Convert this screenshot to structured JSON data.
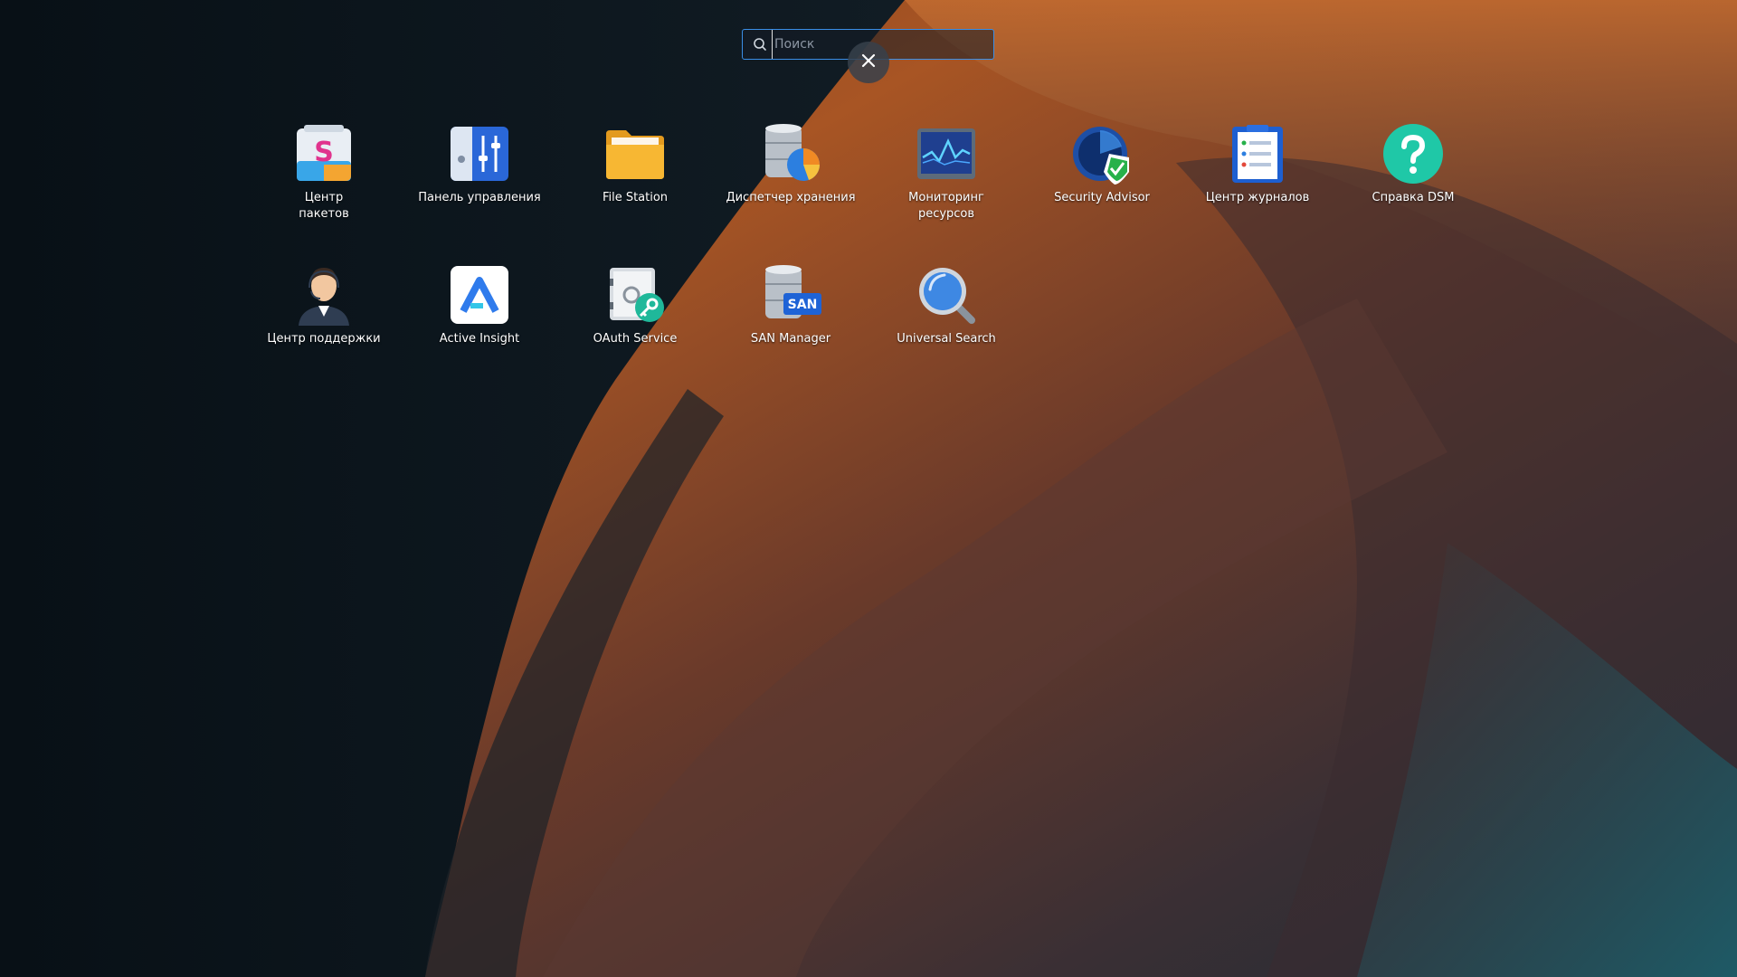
{
  "search": {
    "placeholder": "Поиск",
    "value": ""
  },
  "close": {
    "icon": "close-icon"
  },
  "apps": [
    {
      "label": "Центр\nпакетов",
      "icon": "package-center-icon"
    },
    {
      "label": "Панель управления",
      "icon": "control-panel-icon"
    },
    {
      "label": "File Station",
      "icon": "folder-icon"
    },
    {
      "label": "Диспетчер хранения",
      "icon": "storage-manager-icon"
    },
    {
      "label": "Мониторинг\nресурсов",
      "icon": "resource-monitor-icon"
    },
    {
      "label": "Security Advisor",
      "icon": "security-advisor-icon"
    },
    {
      "label": "Центр журналов",
      "icon": "log-center-icon"
    },
    {
      "label": "Справка DSM",
      "icon": "help-icon"
    },
    {
      "label": "Центр поддержки",
      "icon": "support-center-icon"
    },
    {
      "label": "Active Insight",
      "icon": "active-insight-icon"
    },
    {
      "label": "OAuth Service",
      "icon": "oauth-service-icon"
    },
    {
      "label": "SAN Manager",
      "icon": "san-manager-icon"
    },
    {
      "label": "Universal Search",
      "icon": "universal-search-icon"
    }
  ],
  "icon_text": {
    "san": "SAN"
  },
  "colors": {
    "accent": "#3a8ee6",
    "folder": "#f7b733",
    "help": "#1fc8a7"
  }
}
